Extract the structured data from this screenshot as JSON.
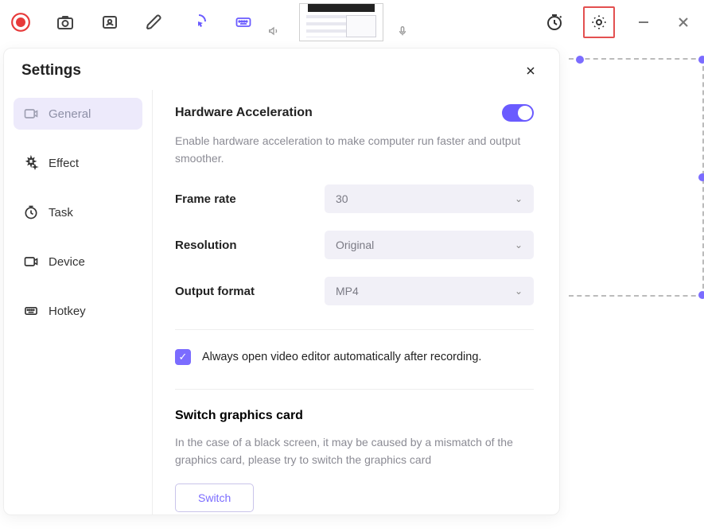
{
  "panel": {
    "title": "Settings"
  },
  "sidebar": {
    "items": [
      {
        "label": "General"
      },
      {
        "label": "Effect"
      },
      {
        "label": "Task"
      },
      {
        "label": "Device"
      },
      {
        "label": "Hotkey"
      }
    ]
  },
  "hardware": {
    "title": "Hardware Acceleration",
    "desc": "Enable hardware acceleration to make computer run faster and output smoother.",
    "enabled": true
  },
  "frame_rate": {
    "label": "Frame rate",
    "value": "30"
  },
  "resolution": {
    "label": "Resolution",
    "value": "Original"
  },
  "output_format": {
    "label": "Output format",
    "value": "MP4"
  },
  "auto_open": {
    "label": "Always open video editor automatically after recording.",
    "checked": true
  },
  "switch_card": {
    "title": "Switch graphics card",
    "desc": "In the case of a black screen, it may be caused by a mismatch of the graphics card, please try to switch the graphics card",
    "button": "Switch"
  }
}
